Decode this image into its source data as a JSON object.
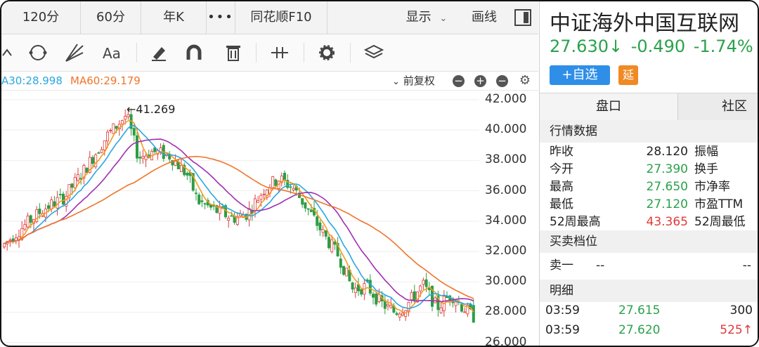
{
  "tabbar": {
    "tabs": [
      "120分",
      "60分",
      "年K",
      "•••",
      "同花顺F10"
    ],
    "display_label": "显示",
    "draw_label": "画线"
  },
  "toolbar": {
    "icons": [
      "line-tool-icon",
      "cycle-icon",
      "fan-icon",
      "text-tool-icon",
      "eraser-icon",
      "magnet-icon",
      "trash-icon",
      "measure-icon",
      "settings-icon",
      "layers-icon"
    ]
  },
  "indicators": {
    "ma30": "A30:28.998",
    "ma60": "MA60:29.179",
    "adjust_label": "前复权",
    "colors": {
      "ma5": "#f29b21",
      "ma10": "#2aa7e0",
      "ma20": "#a12eb1",
      "ma30": "#2aa7e0",
      "ma60": "#f0742a",
      "up": "#e03a3a",
      "down": "#2e9d45"
    }
  },
  "chart": {
    "max_label": "←41.269",
    "y_ticks": [
      "42.000",
      "40.000",
      "38.000",
      "36.000",
      "34.000",
      "32.000",
      "30.000",
      "28.000",
      "26.000"
    ],
    "ylim": [
      25.8,
      42.6
    ]
  },
  "quote": {
    "title": "中证海外中国互联网",
    "price": "27.630",
    "arrow": "↓",
    "change": "-0.490",
    "change_pct": "-1.74%",
    "add_label": "+自选",
    "delay_badge": "延",
    "tabs": [
      "盘口",
      "社区"
    ],
    "section_market": "行情数据",
    "rows": [
      {
        "label": "昨收",
        "value": "28.120",
        "right": "振幅",
        "color": "#222222"
      },
      {
        "label": "今开",
        "value": "27.390",
        "right": "换手",
        "color": "#2aa14b"
      },
      {
        "label": "最高",
        "value": "27.650",
        "right": "市净率",
        "color": "#2aa14b"
      },
      {
        "label": "最低",
        "value": "27.120",
        "right": "市盈TTM",
        "color": "#2aa14b"
      },
      {
        "label": "52周最高",
        "value": "43.365",
        "right": "52周最低",
        "color": "#e03a3a"
      }
    ],
    "section_orderbook": "买卖档位",
    "ask1_label": "卖一",
    "ask1_price": "--",
    "ask1_vol": "--",
    "section_ticks": "明细",
    "ticks": [
      {
        "time": "03:59",
        "price": "27.615",
        "vol": "300",
        "vol_color": "#222222"
      },
      {
        "time": "03:59",
        "price": "27.620",
        "vol": "525↑",
        "vol_color": "#e03a3a"
      }
    ]
  }
}
